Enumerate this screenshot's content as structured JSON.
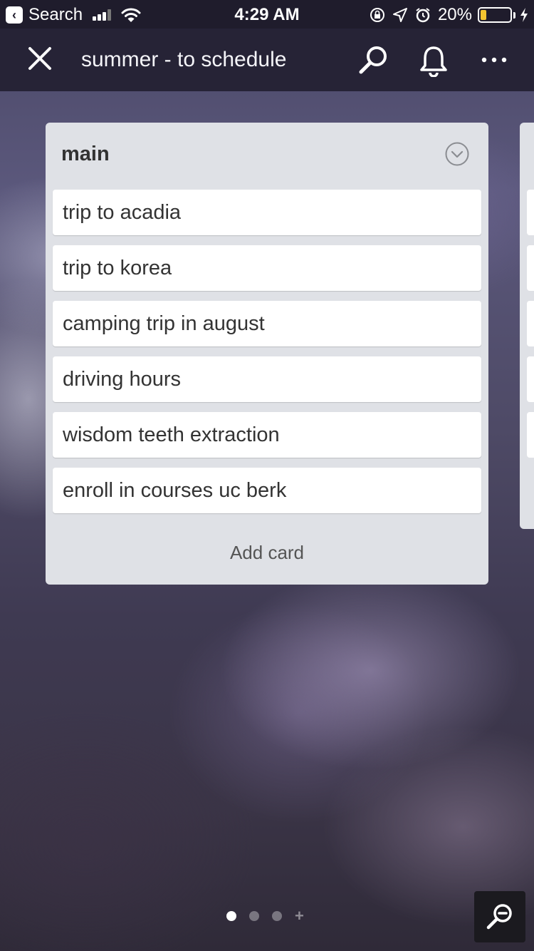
{
  "status_bar": {
    "back_label": "Search",
    "time": "4:29 AM",
    "battery_percent": "20%",
    "battery_level": 0.2,
    "icons": [
      "back-arrow-icon",
      "signal-icon",
      "wifi-icon",
      "orientation-lock-icon",
      "location-icon",
      "alarm-icon",
      "battery-icon",
      "charging-bolt-icon"
    ]
  },
  "header": {
    "title": "summer - to schedule",
    "icons": [
      "close-icon",
      "search-icon",
      "bell-icon",
      "more-icon"
    ]
  },
  "list": {
    "title": "main",
    "menu_icon": "chevron-down-circle-icon",
    "cards": [
      "trip to acadia",
      "trip to korea",
      "camping trip in august",
      "driving hours",
      "wisdom teeth extraction",
      "enroll in courses uc berk"
    ],
    "add_card_label": "Add card"
  },
  "pager": {
    "page_count": 3,
    "active_page": 1,
    "plus_symbol": "+"
  },
  "zoom_icon": "zoom-out-icon",
  "colors": {
    "header_bg": "#262336",
    "list_bg": "#dfe1e6",
    "card_bg": "#ffffff",
    "battery": "#f4c430"
  }
}
